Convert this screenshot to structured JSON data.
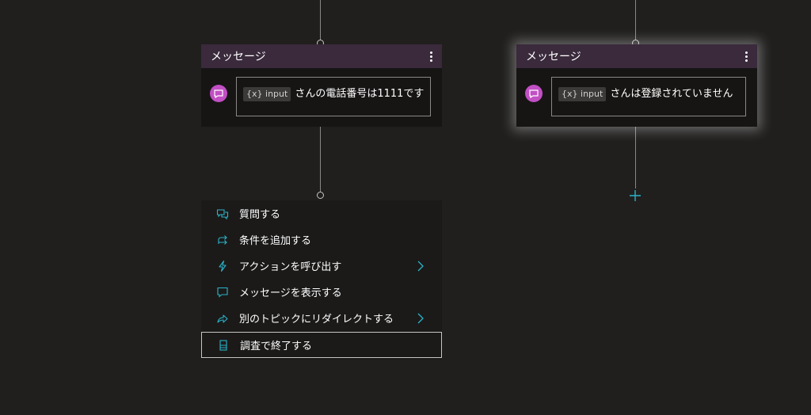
{
  "cards": [
    {
      "title": "メッセージ",
      "variable": "{x}",
      "var_name": "input",
      "text": "さんの電話番号は1111です"
    },
    {
      "title": "メッセージ",
      "variable": "{x}",
      "var_name": "input",
      "text": "さんは登録されていません"
    }
  ],
  "menu": {
    "items": [
      {
        "label": "質問する",
        "icon": "question-chat-icon",
        "has_submenu": false
      },
      {
        "label": "条件を追加する",
        "icon": "branch-icon",
        "has_submenu": false
      },
      {
        "label": "アクションを呼び出す",
        "icon": "lightning-icon",
        "has_submenu": true
      },
      {
        "label": "メッセージを表示する",
        "icon": "chat-icon",
        "has_submenu": false
      },
      {
        "label": "別のトピックにリダイレクトする",
        "icon": "redirect-arrow-icon",
        "has_submenu": true
      },
      {
        "label": "調査で終了する",
        "icon": "end-survey-icon",
        "has_submenu": false
      }
    ]
  },
  "colors": {
    "background": "#201f1e",
    "card_header": "#3a2a3c",
    "avatar": "#c24fc4",
    "accent": "#2ab3c8"
  }
}
